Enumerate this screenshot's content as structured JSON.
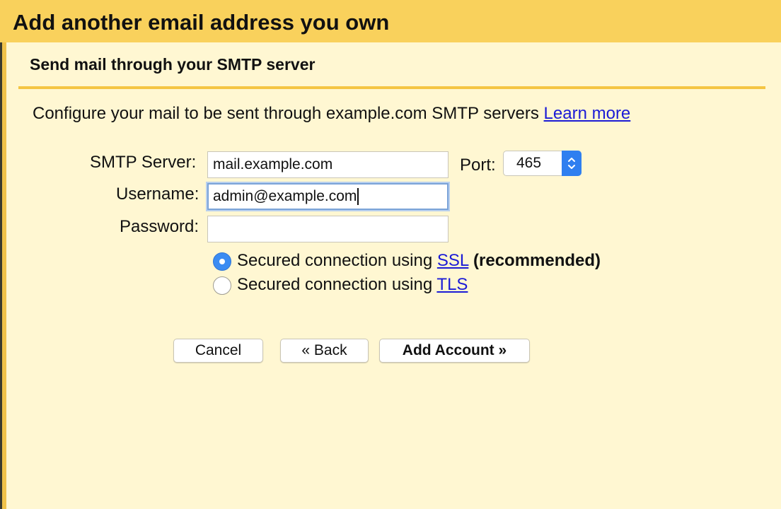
{
  "dialog": {
    "title": "Add another email address you own",
    "section_title": "Send mail through your SMTP server",
    "intro_text": "Configure your mail to be sent through example.com SMTP servers ",
    "learn_more_label": "Learn more"
  },
  "form": {
    "smtp_server_label": "SMTP Server:",
    "smtp_server_value": "mail.example.com",
    "port_label": "Port:",
    "port_value": "465",
    "username_label": "Username:",
    "username_value": "admin@example.com",
    "password_label": "Password:",
    "password_value": ""
  },
  "security": {
    "ssl_prefix": "Secured connection using ",
    "ssl_link": "SSL",
    "ssl_suffix": "(recommended)",
    "tls_prefix": "Secured connection using ",
    "tls_link": "TLS",
    "selected": "SSL"
  },
  "buttons": {
    "cancel_label": "Cancel",
    "back_label": "« Back",
    "add_account_label": "Add Account »"
  },
  "colors": {
    "header_bg": "#f9d15c",
    "panel_bg": "#fff7d2",
    "divider": "#f4c543",
    "link": "#1b1bd6",
    "radio_selected": "#3b8cf2",
    "stepper": "#2f7ff0"
  },
  "icons": {
    "port_stepper": "chevron-up-down-icon"
  }
}
